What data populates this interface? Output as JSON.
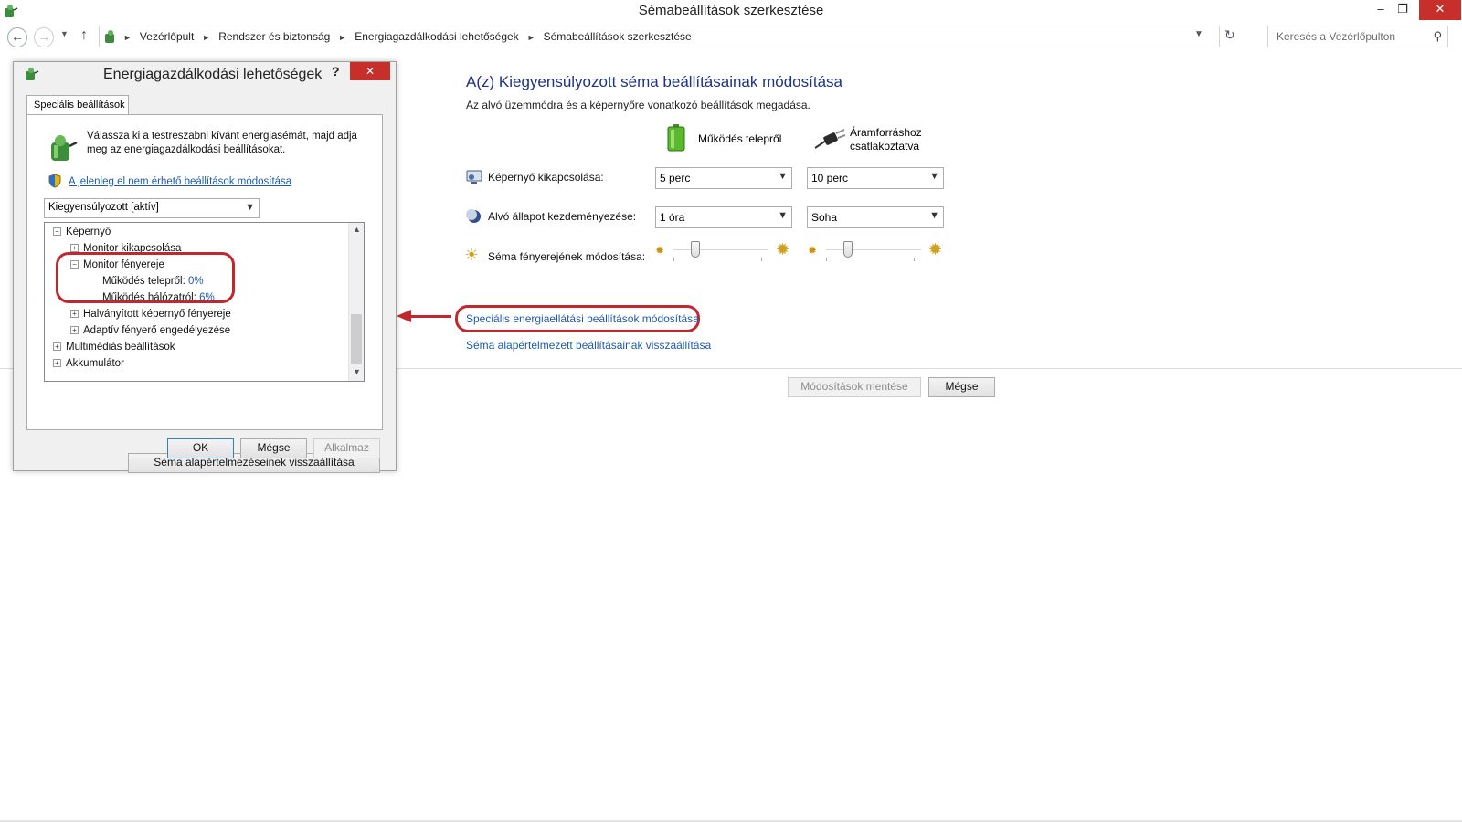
{
  "window": {
    "title": "Sémabeállítások szerkesztése",
    "minimize": "‒",
    "maximize": "❐",
    "close": "✕"
  },
  "address": {
    "crumbs": [
      "Vezérlőpult",
      "Rendszer és biztonság",
      "Energiagazdálkodási lehetőségek",
      "Sémabeállítások szerkesztése"
    ],
    "separator": "►",
    "search_placeholder": "Keresés a Vezérlőpulton"
  },
  "main": {
    "heading": "A(z) Kiegyensúlyozott séma beállításainak módosítása",
    "subtitle": "Az alvó üzemmódra és a képernyőre vonatkozó beállítások megadása.",
    "battery_label": "Működés telepről",
    "plugged_label_line1": "Áramforráshoz",
    "plugged_label_line2": "csatlakoztatva",
    "rows": [
      {
        "label": "Képernyő kikapcsolása:",
        "battery": "5 perc",
        "plugged": "10 perc"
      },
      {
        "label": "Alvó állapot kezdeményezése:",
        "battery": "1 óra",
        "plugged": "Soha"
      },
      {
        "label": "Séma fényerejének módosítása:"
      }
    ],
    "brightness": {
      "battery_fraction": 0.2,
      "plugged_fraction": 0.2
    },
    "advanced_link": "Speciális energiaellátási beállítások módosítása",
    "restore_link": "Séma alapértelmezett beállításainak visszaállítása",
    "save_button": "Módosítások mentése",
    "cancel_button": "Mégse"
  },
  "dialog": {
    "title": "Energiagazdálkodási lehetőségek",
    "help": "?",
    "close": "✕",
    "tab": "Speciális beállítások",
    "description": "Válassza ki a testreszabni kívánt energiasémát, majd adja meg az energiagazdálkodási beállításokat.",
    "unavailable_link": "A jelenleg el nem érhető beállítások módosítása",
    "plan_select": "Kiegyensúlyozott [aktív]",
    "tree": [
      {
        "label": "Képernyő",
        "toggle": "−",
        "level": 0
      },
      {
        "label": "Monitor kikapcsolása",
        "toggle": "+",
        "level": 1
      },
      {
        "label": "Monitor fényereje",
        "toggle": "−",
        "level": 1
      },
      {
        "label": "Működés telepről:",
        "value": "0%",
        "level": 2
      },
      {
        "label": "Működés hálózatról:",
        "value": "6%",
        "level": 2
      },
      {
        "label": "Halványított képernyő fényereje",
        "toggle": "+",
        "level": 1
      },
      {
        "label": "Adaptív fényerő engedélyezése",
        "toggle": "+",
        "level": 1
      },
      {
        "label": "Multimédiás beállítások",
        "toggle": "+",
        "level": 0
      },
      {
        "label": "Akkumulátor",
        "toggle": "+",
        "level": 0
      }
    ],
    "restore_button": "Séma alapértelmezéseinek visszaállítása",
    "ok_button": "OK",
    "cancel_button": "Mégse",
    "apply_button": "Alkalmaz"
  },
  "colors": {
    "annotation": "#c1272d",
    "link": "#1e5bb0",
    "heading": "#1e3287",
    "close_button": "#c7302a"
  }
}
